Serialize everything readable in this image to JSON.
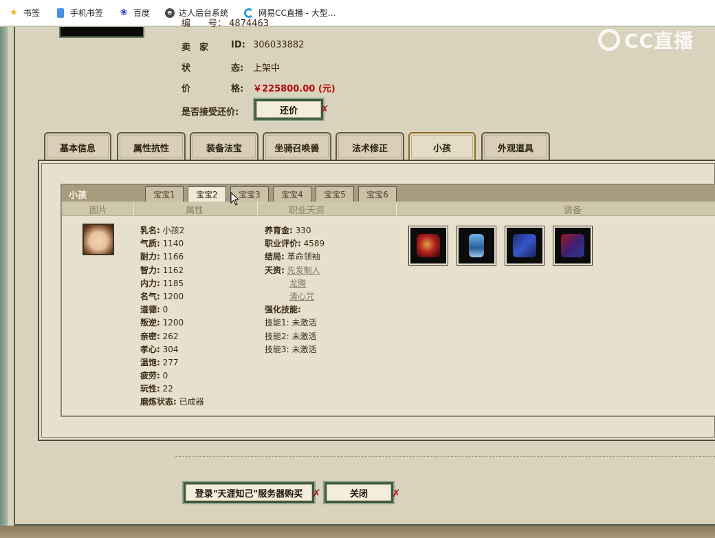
{
  "bookmarks": [
    {
      "icon": "star-icon",
      "label": "书签"
    },
    {
      "icon": "phone-icon",
      "label": "手机书签"
    },
    {
      "icon": "baidu-paw-icon",
      "label": "百度"
    },
    {
      "icon": "edge-icon",
      "label": "达人后台系统"
    },
    {
      "icon": "cc-icon",
      "label": "网易CC直播 - 大型..."
    }
  ],
  "watermark": "CC直播",
  "seller": {
    "clipped_line": "编　　号： 4874463",
    "id_label_a": "卖　家",
    "id_label_b": "ID:",
    "id_value": "306033882",
    "status_label_a": "状",
    "status_label_b": "态:",
    "status_value": "上架中",
    "price_label_a": "价",
    "price_label_b": "格:",
    "price_value": "￥225800.00 (元)",
    "bargain_label": "是否接受还价:",
    "bargain_button": "还价"
  },
  "main_tabs": [
    "基本信息",
    "属性抗性",
    "装备法宝",
    "坐骑召唤兽",
    "法术修正",
    "小孩",
    "外观道具"
  ],
  "active_main_tab": 5,
  "child_panel": {
    "title": "小孩",
    "tabs": [
      "宝宝1",
      "宝宝2",
      "宝宝3",
      "宝宝4",
      "宝宝5",
      "宝宝6"
    ],
    "active_tab": 1,
    "columns": [
      "图片",
      "属性",
      "职业天资",
      "装备"
    ],
    "attributes": [
      {
        "label": "乳名:",
        "value": "小孩2"
      },
      {
        "label": "气质:",
        "value": "1140"
      },
      {
        "label": "耐力:",
        "value": "1166"
      },
      {
        "label": "智力:",
        "value": "1162"
      },
      {
        "label": "内力:",
        "value": "1185"
      },
      {
        "label": "名气:",
        "value": "1200"
      },
      {
        "label": "道德:",
        "value": "0"
      },
      {
        "label": "叛逆:",
        "value": "1200"
      },
      {
        "label": "亲密:",
        "value": "262"
      },
      {
        "label": "孝心:",
        "value": "304"
      },
      {
        "label": "温饱:",
        "value": "277"
      },
      {
        "label": "疲劳:",
        "value": "0"
      },
      {
        "label": "玩性:",
        "value": "22"
      },
      {
        "label": "磨炼状态:",
        "value": "已成器"
      }
    ],
    "career": {
      "nurture_label": "养育金:",
      "nurture_value": "330",
      "rating_label": "职业评价:",
      "rating_value": "4589",
      "ending_label": "结局:",
      "ending_value": "革命领袖",
      "talent_label": "天资:",
      "talents": [
        "先发制人",
        "龙腾",
        "清心咒"
      ],
      "skill_head": "强化技能:",
      "skills": [
        {
          "label": "技能1:",
          "value": "未激活"
        },
        {
          "label": "技能2:",
          "value": "未激活"
        },
        {
          "label": "技能3:",
          "value": "未激活"
        }
      ]
    },
    "equipment_icons": [
      "red-armor-icon",
      "blue-robe-icon",
      "blue-book-icon",
      "red-blue-box-icon"
    ]
  },
  "footer": {
    "login_button": "登录\"天涯知己\"服务器购买",
    "close_button": "关闭"
  },
  "colors": {
    "price": "#b8060c",
    "tab_active_border": "#8a6a20",
    "button_frame": "#3f5a44"
  }
}
